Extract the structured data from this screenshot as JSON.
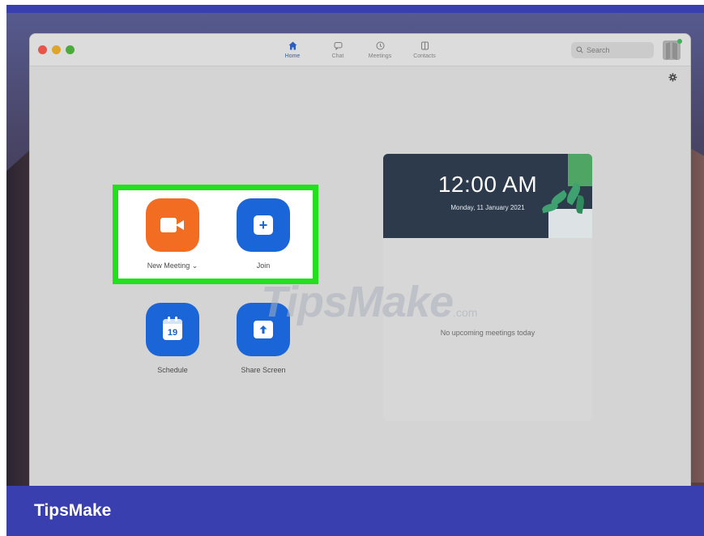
{
  "nav": {
    "items": [
      {
        "label": "Home",
        "icon": "home-icon",
        "active": true
      },
      {
        "label": "Chat",
        "icon": "chat-icon",
        "active": false
      },
      {
        "label": "Meetings",
        "icon": "clock-icon",
        "active": false
      },
      {
        "label": "Contacts",
        "icon": "contacts-icon",
        "active": false
      }
    ]
  },
  "search": {
    "placeholder": "Search"
  },
  "actions": {
    "new_meeting": {
      "label": "New Meeting",
      "chevron": "⌄",
      "color": "#f26d22"
    },
    "join": {
      "label": "Join",
      "color": "#1a66d9"
    },
    "schedule": {
      "label": "Schedule",
      "day": "19",
      "color": "#1a66d9"
    },
    "share_screen": {
      "label": "Share Screen",
      "color": "#1a66d9"
    }
  },
  "clock": {
    "time": "12:00 AM",
    "date": "Monday, 11 January 2021"
  },
  "upcoming": {
    "empty_text": "No upcoming meetings today"
  },
  "watermark": {
    "text": "TipsMake",
    "suffix": ".com"
  },
  "brand": {
    "text": "TipsMake",
    "bar_color": "#3a3fb0"
  },
  "highlight_color": "#22e01c"
}
